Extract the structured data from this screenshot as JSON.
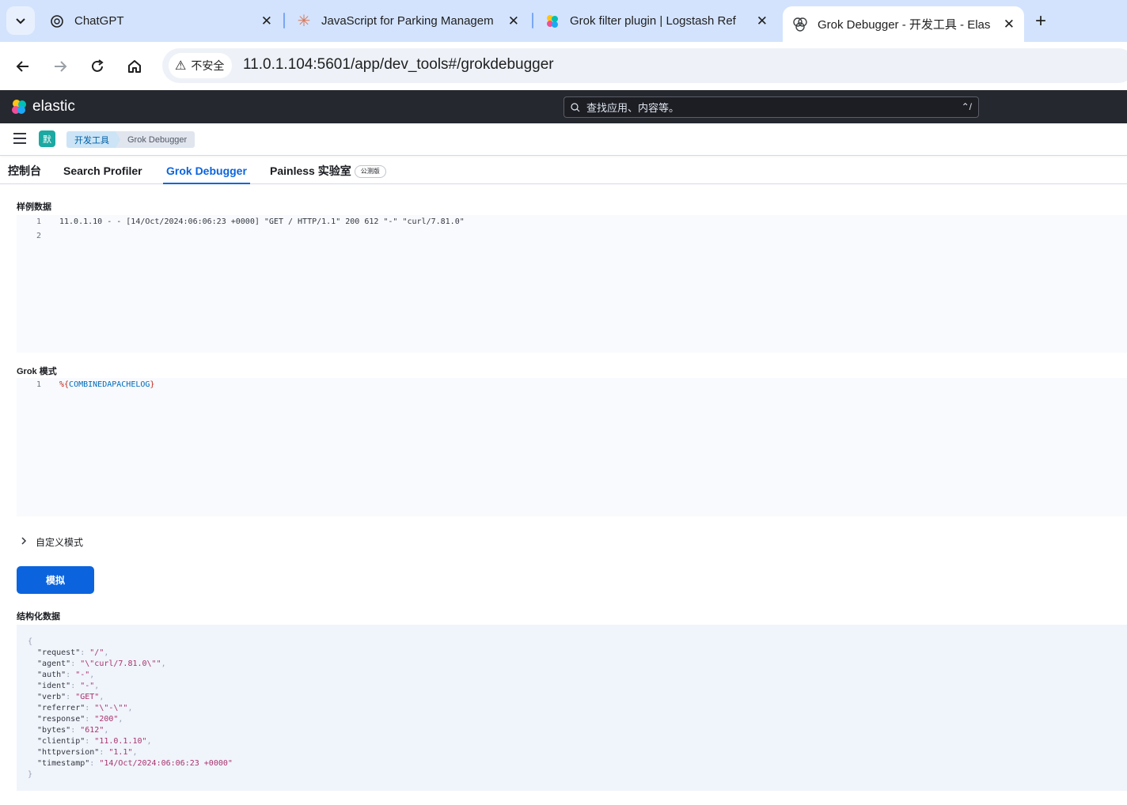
{
  "browser": {
    "tabs": [
      {
        "title": "ChatGPT",
        "icon": "openai-icon"
      },
      {
        "title": "JavaScript for Parking Managem",
        "icon": "claude-icon"
      },
      {
        "title": "Grok filter plugin | Logstash Ref",
        "icon": "elastic-icon"
      },
      {
        "title": "Grok Debugger - 开发工具 - Elas",
        "icon": "kibana-icon",
        "active": true
      }
    ],
    "security_label": "不安全",
    "url": "11.0.1.104:5601/app/dev_tools#/grokdebugger"
  },
  "kibana": {
    "logo_text": "elastic",
    "search_placeholder": "查找应用、内容等。",
    "search_shortcut": "⌃/",
    "space_avatar": "默",
    "breadcrumbs": [
      "开发工具",
      "Grok Debugger"
    ],
    "tabs": [
      {
        "label": "控制台"
      },
      {
        "label": "Search Profiler"
      },
      {
        "label": "Grok Debugger",
        "selected": true
      },
      {
        "label": "Painless 实验室",
        "badge": "公测版"
      }
    ]
  },
  "grok": {
    "sample_label": "样例数据",
    "sample_lines": [
      {
        "num": "1",
        "text": "11.0.1.10 - - [14/Oct/2024:06:06:23 +0000] \"GET / HTTP/1.1\" 200 612 \"-\" \"curl/7.81.0\""
      },
      {
        "num": "2",
        "text": ""
      }
    ],
    "pattern_label": "Grok 模式",
    "pattern_line_num": "1",
    "pattern_open": "%{",
    "pattern_name": "COMBINEDAPACHELOG",
    "pattern_close": "}",
    "custom_patterns_label": "自定义模式",
    "simulate_label": "模拟",
    "structured_label": "结构化数据",
    "structured_output": [
      {
        "key": "request",
        "value": "/"
      },
      {
        "key": "agent",
        "value": "\\\"curl/7.81.0\\\""
      },
      {
        "key": "auth",
        "value": "-"
      },
      {
        "key": "ident",
        "value": "-"
      },
      {
        "key": "verb",
        "value": "GET"
      },
      {
        "key": "referrer",
        "value": "\\\"-\\\""
      },
      {
        "key": "response",
        "value": "200"
      },
      {
        "key": "bytes",
        "value": "612"
      },
      {
        "key": "clientip",
        "value": "11.0.1.10"
      },
      {
        "key": "httpversion",
        "value": "1.1"
      },
      {
        "key": "timestamp",
        "value": "14/Oct/2024:06:06:23 +0000"
      }
    ]
  },
  "colors": {
    "accent": "#0b64dd",
    "header_bg": "#25282f",
    "space_avatar": "#1ba9a2"
  }
}
